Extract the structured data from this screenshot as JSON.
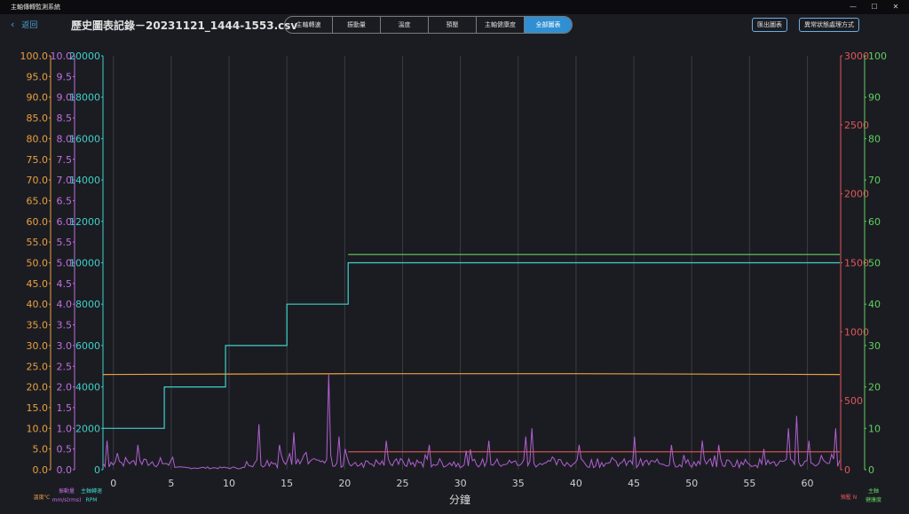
{
  "window": {
    "title": "主軸傳轉監測系統",
    "min": "—",
    "max": "☐",
    "close": "✕"
  },
  "header": {
    "back_label": "返回",
    "page_title": "歷史圖表記錄－20231121_1444-1553.csv",
    "tabs": [
      "主軸轉速",
      "振動量",
      "溫度",
      "預壓",
      "主軸健康度",
      "全部圖表"
    ],
    "active_tab": 5,
    "export_label": "匯出圖表",
    "abnormal_label": "異常狀態處理方式"
  },
  "chart_data": {
    "type": "line",
    "xlabel": "分鐘",
    "xlim": [
      -0.9,
      62.8
    ],
    "x_ticks": [
      0,
      5,
      10,
      15,
      20,
      25,
      30,
      35,
      40,
      45,
      50,
      55,
      60
    ],
    "axes": [
      {
        "label": "溫度℃",
        "min": 0,
        "max": 100,
        "step": 5,
        "decimals": 1,
        "color": "#e8a040"
      },
      {
        "label": "振動量 mm/s(rms)",
        "min": 0,
        "max": 10,
        "step": 0.5,
        "decimals": 1,
        "color": "#c070e0"
      },
      {
        "label": "主軸轉速 RPM",
        "min": 0,
        "max": 20000,
        "step": 2000,
        "decimals": 0,
        "color": "#40d0c8"
      },
      {
        "label": "預壓 N",
        "min": 0,
        "max": 3000,
        "step": 500,
        "decimals": 0,
        "color": "#e05858"
      },
      {
        "label": "主軸健康度",
        "min": 0,
        "max": 100,
        "step": 10,
        "decimals": 0,
        "color": "#60d060"
      }
    ],
    "series": [
      {
        "axis": 2,
        "color": "#40d0c8",
        "points": [
          [
            -0.9,
            2000
          ],
          [
            4.4,
            2000
          ],
          [
            4.4,
            4000
          ],
          [
            9.7,
            4000
          ],
          [
            9.7,
            6000
          ],
          [
            15.0,
            6000
          ],
          [
            15.0,
            8000
          ],
          [
            20.3,
            8000
          ],
          [
            20.3,
            10000
          ],
          [
            62.8,
            10000
          ]
        ]
      },
      {
        "axis": 0,
        "color": "#e8a040",
        "points": [
          [
            -0.9,
            23.0
          ],
          [
            20.3,
            23.2
          ],
          [
            40.0,
            23.2
          ],
          [
            62.8,
            23.0
          ]
        ]
      },
      {
        "axis": 4,
        "color": "#60d060",
        "points": [
          [
            20.3,
            52
          ],
          [
            62.8,
            52
          ]
        ]
      },
      {
        "axis": 3,
        "color": "#e05858",
        "points": [
          [
            20.3,
            130
          ],
          [
            62.8,
            130
          ]
        ]
      }
    ],
    "vibration": {
      "axis": 1,
      "color": "#b060d0",
      "x_start": -0.9,
      "x_end": 62.8,
      "count": 360,
      "spikes": [
        [
          -0.6,
          0.7
        ],
        [
          0.3,
          0.4
        ],
        [
          2.1,
          0.6
        ],
        [
          5.2,
          0.3
        ],
        [
          12.6,
          1.1
        ],
        [
          14.3,
          0.6
        ],
        [
          15.2,
          0.4
        ],
        [
          15.6,
          0.9
        ],
        [
          18.7,
          2.3
        ],
        [
          19.5,
          0.8
        ],
        [
          20.0,
          0.5
        ],
        [
          23.6,
          0.7
        ],
        [
          27.3,
          0.6
        ],
        [
          32.4,
          0.7
        ],
        [
          35.6,
          0.8
        ],
        [
          36.1,
          1.0
        ],
        [
          40.2,
          0.6
        ],
        [
          45.0,
          0.8
        ],
        [
          48.2,
          0.6
        ],
        [
          51.0,
          0.7
        ],
        [
          52.4,
          0.6
        ],
        [
          56.2,
          0.5
        ],
        [
          58.4,
          1.0
        ],
        [
          59.1,
          1.3
        ],
        [
          60.2,
          0.7
        ],
        [
          62.5,
          1.0
        ]
      ]
    }
  }
}
